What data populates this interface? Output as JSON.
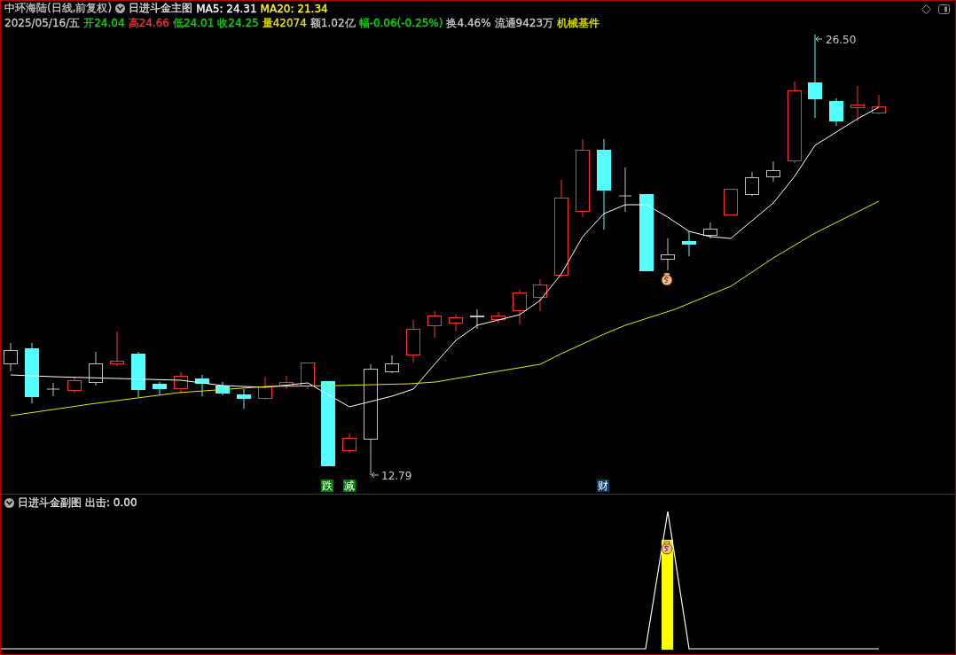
{
  "header": {
    "stock": "中环海陆(日线,前复权)",
    "indicator": "日进斗金主图",
    "ma5": "MA5: 24.31",
    "ma20": "MA20: 21.34"
  },
  "quote": [
    {
      "text": "2025/05/16/五",
      "color": "#c8c8c8"
    },
    {
      "text": "开24.04",
      "color": "#00e000"
    },
    {
      "text": "高24.66",
      "color": "#ff3030"
    },
    {
      "text": "低24.01",
      "color": "#00e000"
    },
    {
      "text": "收24.25",
      "color": "#00e000"
    },
    {
      "text": "量42074",
      "color": "#e0e000"
    },
    {
      "text": "额1.02亿",
      "color": "#c8c8c8"
    },
    {
      "text": "幅-0.06(-0.25%)",
      "color": "#00e000"
    },
    {
      "text": "换4.46%",
      "color": "#c8c8c8"
    },
    {
      "text": "流通9423万",
      "color": "#c8c8c8"
    },
    {
      "text": "机械基件",
      "color": "#e0e000"
    }
  ],
  "chart": {
    "high_label": "26.50",
    "low_label": "12.79"
  },
  "markers": [
    {
      "text": "跌",
      "color": "#008000"
    },
    {
      "text": "减",
      "color": "#008000"
    },
    {
      "text": "财",
      "color": "#0a3a6a"
    }
  ],
  "sub": {
    "indicator": "日进斗金副图",
    "reading": "出击: 0.00"
  }
}
